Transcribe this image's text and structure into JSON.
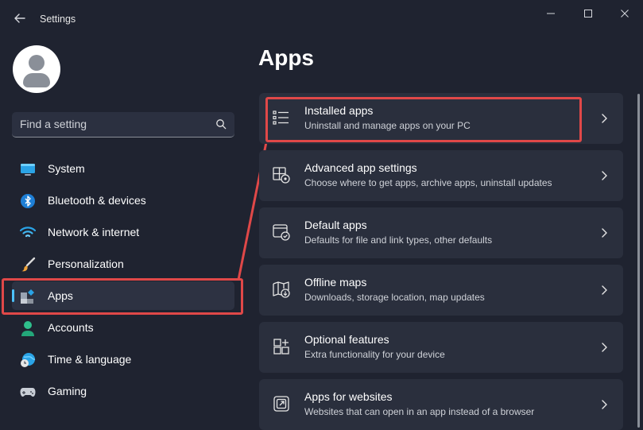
{
  "window": {
    "title": "Settings",
    "controls": [
      "minimize-icon",
      "maximize-icon",
      "close-icon"
    ]
  },
  "sidebar": {
    "search_placeholder": "Find a setting",
    "items": [
      {
        "label": "System",
        "icon": "system-icon"
      },
      {
        "label": "Bluetooth & devices",
        "icon": "bluetooth-icon"
      },
      {
        "label": "Network & internet",
        "icon": "wifi-icon"
      },
      {
        "label": "Personalization",
        "icon": "brush-icon"
      },
      {
        "label": "Apps",
        "icon": "apps-icon",
        "selected": true
      },
      {
        "label": "Accounts",
        "icon": "person-icon"
      },
      {
        "label": "Time & language",
        "icon": "globe-clock-icon"
      },
      {
        "label": "Gaming",
        "icon": "gamepad-icon"
      }
    ]
  },
  "main": {
    "title": "Apps",
    "cards": [
      {
        "title": "Installed apps",
        "description": "Uninstall and manage apps on your PC",
        "icon": "list-icon",
        "highlighted": true
      },
      {
        "title": "Advanced app settings",
        "description": "Choose where to get apps, archive apps, uninstall updates",
        "icon": "app-settings-icon"
      },
      {
        "title": "Default apps",
        "description": "Defaults for file and link types, other defaults",
        "icon": "default-apps-icon"
      },
      {
        "title": "Offline maps",
        "description": "Downloads, storage location, map updates",
        "icon": "map-download-icon"
      },
      {
        "title": "Optional features",
        "description": "Extra functionality for your device",
        "icon": "add-feature-icon"
      },
      {
        "title": "Apps for websites",
        "description": "Websites that can open in an app instead of a browser",
        "icon": "open-external-icon"
      }
    ]
  },
  "colors": {
    "background": "#1f2330",
    "card": "#2a2f3d",
    "accent": "#4cc2ff",
    "annotation": "#e04848"
  }
}
